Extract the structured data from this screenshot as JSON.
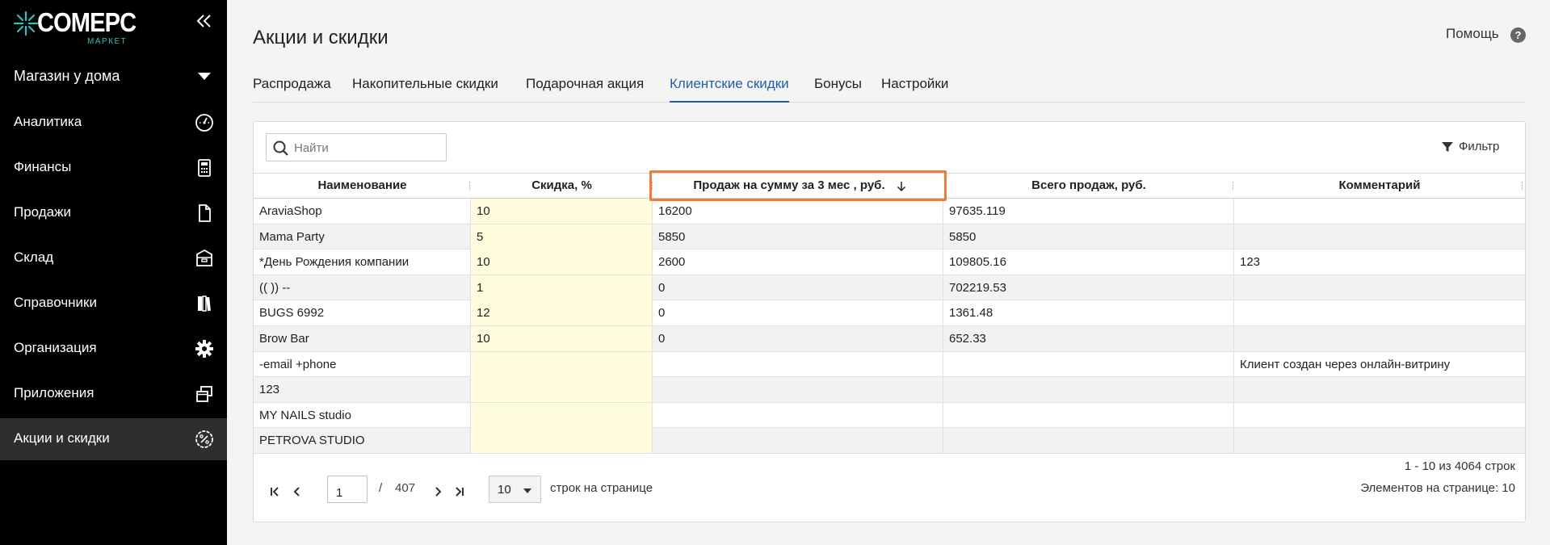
{
  "brand": {
    "name": "COMEPC",
    "subtitle": "МАРКЕТ",
    "accent": "#2ec4c0"
  },
  "sidebar": {
    "store": "Магазин у дома",
    "items": [
      {
        "label": "Аналитика",
        "icon": "speedometer-icon"
      },
      {
        "label": "Финансы",
        "icon": "calculator-icon"
      },
      {
        "label": "Продажи",
        "icon": "document-icon"
      },
      {
        "label": "Склад",
        "icon": "warehouse-box-icon"
      },
      {
        "label": "Справочники",
        "icon": "books-icon"
      },
      {
        "label": "Организация",
        "icon": "gear-icon"
      },
      {
        "label": "Приложения",
        "icon": "windows-icon"
      },
      {
        "label": "Акции и скидки",
        "icon": "percent-badge-icon",
        "active": true
      }
    ]
  },
  "header": {
    "title": "Акции и скидки",
    "help": "Помощь"
  },
  "tabs": [
    {
      "label": "Распродажа"
    },
    {
      "label": "Накопительные скидки"
    },
    {
      "label": "Подарочная акция"
    },
    {
      "label": "Клиентские скидки",
      "active": true
    },
    {
      "label": "Бонусы"
    },
    {
      "label": "Настройки"
    }
  ],
  "search": {
    "placeholder": "Найти",
    "value": ""
  },
  "filter": {
    "label": "Фильтр"
  },
  "table": {
    "columns": [
      "Наименование",
      "Скидка, %",
      "Продаж на сумму за 3 мес , руб.",
      "Всего продаж, руб.",
      "Комментарий"
    ],
    "sorted_column": "Продаж на сумму за 3 мес , руб.",
    "sort_direction": "descending",
    "rows": [
      [
        "AraviaShop",
        "10",
        "16200",
        "97635.119",
        ""
      ],
      [
        "Mama Party",
        "5",
        "5850",
        "5850",
        ""
      ],
      [
        "*День Рождения компании",
        "10",
        "2600",
        "109805.16",
        "123"
      ],
      [
        "(( )) --",
        "1",
        "0",
        "702219.53",
        ""
      ],
      [
        "BUGS 6992",
        "12",
        "0",
        "1361.48",
        ""
      ],
      [
        "Brow Bar",
        "10",
        "0",
        "652.33",
        ""
      ],
      [
        "-email +phone",
        "",
        "",
        "",
        "Клиент создан через онлайн-витрину"
      ],
      [
        "123",
        "",
        "",
        "",
        ""
      ],
      [
        "MY NAILS studio",
        "",
        "",
        "",
        ""
      ],
      [
        "PETROVA STUDIO",
        "",
        "",
        "",
        ""
      ]
    ]
  },
  "pager": {
    "page": "1",
    "slash": "/",
    "total_pages": "407",
    "page_size": "10",
    "page_size_label": "строк на странице",
    "range": "1 - 10 из 4064 строк",
    "per_page": "Элементов на странице: 10"
  },
  "colors": {
    "active_tab": "#1f5fa8",
    "sort_highlight": "#f07b3a",
    "discount_cell": "#fefcdc"
  }
}
